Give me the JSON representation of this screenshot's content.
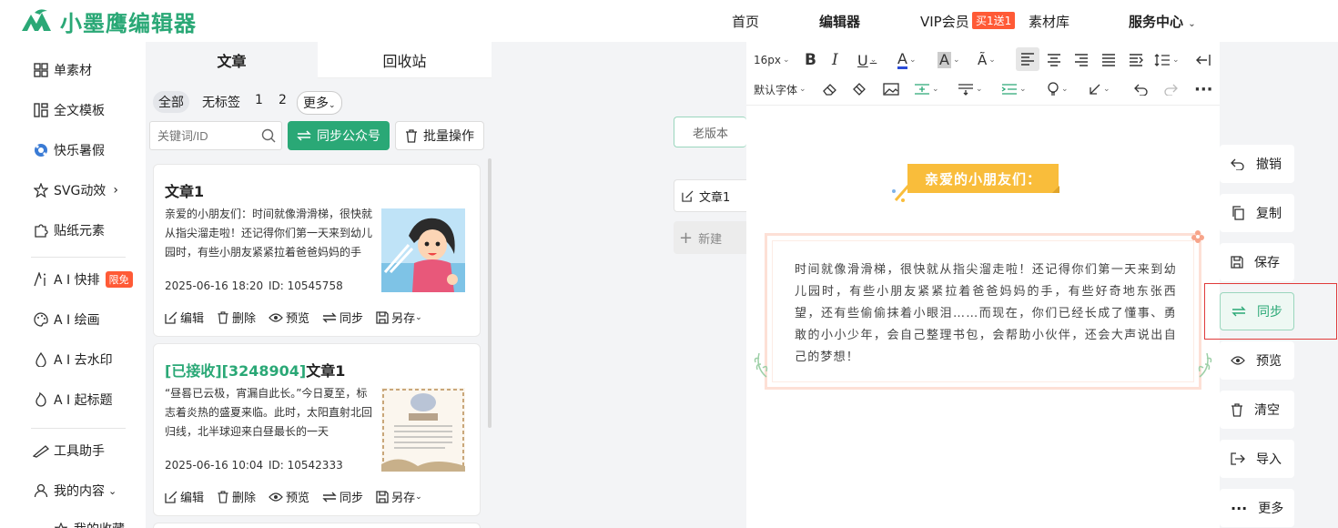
{
  "header": {
    "logo_text": "小墨鹰编辑器",
    "nav": [
      "首页",
      "编辑器",
      "VIP会员",
      "素材库",
      "服务中心"
    ],
    "vip_badge": "买1送1",
    "brand_color": "#2aa876"
  },
  "sidebar": {
    "items": [
      {
        "label": "单素材",
        "icon": "grid-icon"
      },
      {
        "label": "全文模板",
        "icon": "template-icon"
      },
      {
        "label": "快乐暑假",
        "icon": "ball-icon"
      },
      {
        "label": "SVG动效",
        "icon": "star-icon"
      },
      {
        "label": "贴纸元素",
        "icon": "puzzle-icon"
      },
      {
        "label": "A I 快排",
        "icon": "ai-icon",
        "badge": "限免"
      },
      {
        "label": "A I 绘画",
        "icon": "palette-icon"
      },
      {
        "label": "A I 去水印",
        "icon": "drop-icon"
      },
      {
        "label": "A I 起标题",
        "icon": "flame-icon"
      },
      {
        "label": "工具助手",
        "icon": "ruler-icon"
      },
      {
        "label": "我的内容",
        "icon": "user-icon"
      },
      {
        "label": "我的收藏",
        "icon": "star-icon"
      }
    ]
  },
  "list": {
    "tabs": [
      "文章",
      "回收站"
    ],
    "filters": [
      "全部",
      "无标签",
      "1",
      "2",
      "更多"
    ],
    "search_placeholder": "关键词/ID",
    "sync_button": "同步公众号",
    "batch_button": "批量操作",
    "actions": [
      "编辑",
      "删除",
      "预览",
      "同步",
      "另存"
    ],
    "cards": [
      {
        "title_prefix": "",
        "title": "文章1",
        "excerpt": "亲爱的小朋友们：时间就像滑滑梯，很快就从指尖溜走啦！还记得你们第一天来到幼儿园时，有些小朋友紧紧拉着爸爸妈妈的手",
        "date": "2025-06-16 18:20",
        "id": "ID: 10545758"
      },
      {
        "title_prefix": "[已接收][3248904]",
        "title": "文章1",
        "excerpt": "“昼晷已云极，宵漏自此长。”今日夏至，标志着炎热的盛夏来临。此时，太阳直射北回归线，北半球迎来白昼最长的一天",
        "date": "2025-06-16 10:04",
        "id": "ID: 10542333"
      }
    ]
  },
  "middle": {
    "old_version": "老版本",
    "doc_name": "文章1",
    "new_doc": "新建"
  },
  "editor": {
    "font_size": "16px",
    "font_family": "默认字体",
    "heading": "亲爱的小朋友们：",
    "body": "时间就像滑滑梯，很快就从指尖溜走啦！还记得你们第一天来到幼儿园时，有些小朋友紧紧拉着爸爸妈妈的手，有些好奇地东张西望，还有些偷偷抹着小眼泪……而现在，你们已经长成了懂事、勇敢的小小少年，会自己整理书包，会帮助小伙伴，还会大声说出自己的梦想！"
  },
  "right_actions": [
    "撤销",
    "复制",
    "保存",
    "同步",
    "预览",
    "清空",
    "导入",
    "更多"
  ]
}
